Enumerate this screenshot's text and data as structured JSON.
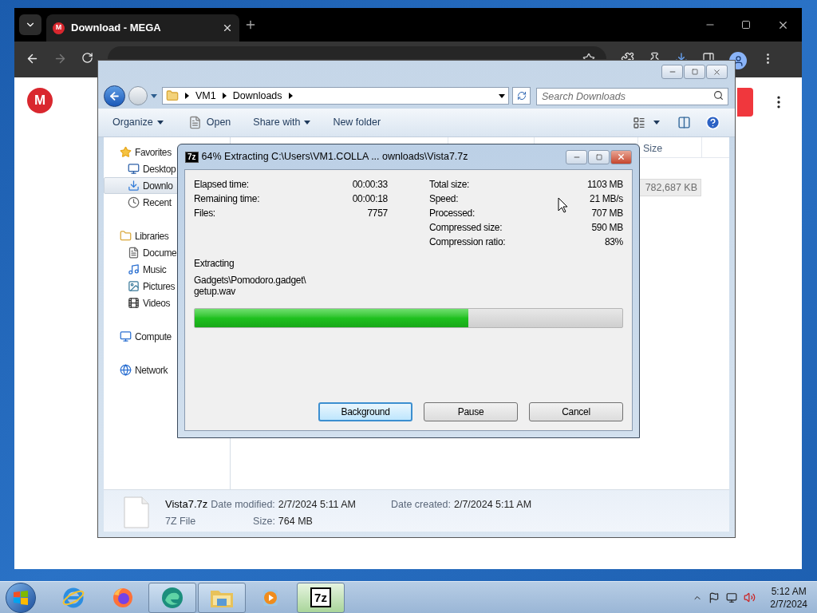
{
  "browser": {
    "tab_title": "Download - MEGA",
    "logo_letter": "M",
    "page_logo_letter": "M"
  },
  "explorer": {
    "breadcrumb": [
      "VM1",
      "Downloads"
    ],
    "search": {
      "placeholder": "Search Downloads"
    },
    "toolbar": [
      "Organize",
      "Open",
      "Share with",
      "New folder"
    ],
    "nav": [
      {
        "label": "Favorites",
        "kind": "star",
        "selected": false,
        "children": [
          {
            "label": "Desktop",
            "kind": "desktop",
            "selected": false
          },
          {
            "label": "Downlo",
            "kind": "downloads",
            "selected": true
          },
          {
            "label": "Recent",
            "kind": "recent",
            "selected": false
          }
        ]
      },
      {
        "label": "Libraries",
        "kind": "library",
        "selected": false,
        "children": [
          {
            "label": "Docume",
            "kind": "document",
            "selected": false
          },
          {
            "label": "Music",
            "kind": "music",
            "selected": false
          },
          {
            "label": "Pictures",
            "kind": "pictures",
            "selected": false
          },
          {
            "label": "Videos",
            "kind": "videos",
            "selected": false
          }
        ]
      },
      {
        "label": "Compute",
        "kind": "computer",
        "selected": false
      },
      {
        "label": "Network",
        "kind": "network",
        "selected": false
      }
    ],
    "column_header": "Size",
    "file_row": {
      "size": "782,687 KB",
      "selected": true
    },
    "details": {
      "name": "Vista7.7z",
      "type": "7Z File",
      "fields": [
        {
          "label": "Date modified:",
          "value": "2/7/2024 5:11 AM"
        },
        {
          "label": "Size:",
          "value": "764 MB"
        },
        {
          "label": "Date created:",
          "value": "2/7/2024 5:11 AM"
        }
      ]
    }
  },
  "dialog": {
    "icon_label": "7z",
    "title": "64% Extracting C:\\Users\\VM1.COLLA ... ownloads\\Vista7.7z",
    "left_stats": [
      {
        "label": "Elapsed time:",
        "value": "00:00:33"
      },
      {
        "label": "Remaining time:",
        "value": "00:00:18"
      },
      {
        "label": "Files:",
        "value": "7757"
      }
    ],
    "right_stats": [
      {
        "label": "Total size:",
        "value": "1103 MB"
      },
      {
        "label": "Speed:",
        "value": "21 MB/s"
      },
      {
        "label": "Processed:",
        "value": "707 MB"
      },
      {
        "label": "Compressed size:",
        "value": "590 MB"
      },
      {
        "label": "Compression ratio:",
        "value": "83%"
      }
    ],
    "status": "Extracting",
    "current_file": "Gadgets\\Pomodoro.gadget\\\ngetup.wav",
    "progress": {
      "level": 0.64
    },
    "buttons": [
      {
        "label": "Background",
        "focused": true
      },
      {
        "label": "Pause",
        "focused": false
      },
      {
        "label": "Cancel",
        "focused": false
      }
    ]
  },
  "taskbar": {
    "items": [
      {
        "kind": "ie",
        "running": false,
        "selected": false
      },
      {
        "kind": "firefox",
        "running": false,
        "selected": false
      },
      {
        "kind": "edge",
        "running": true,
        "selected": false
      },
      {
        "kind": "explorer",
        "running": true,
        "selected": false
      },
      {
        "kind": "media",
        "running": false,
        "selected": false
      },
      {
        "kind": "sevenzip",
        "label": "7z",
        "running": true,
        "selected": true
      }
    ],
    "time": "5:12 AM",
    "date": "2/7/2024"
  }
}
